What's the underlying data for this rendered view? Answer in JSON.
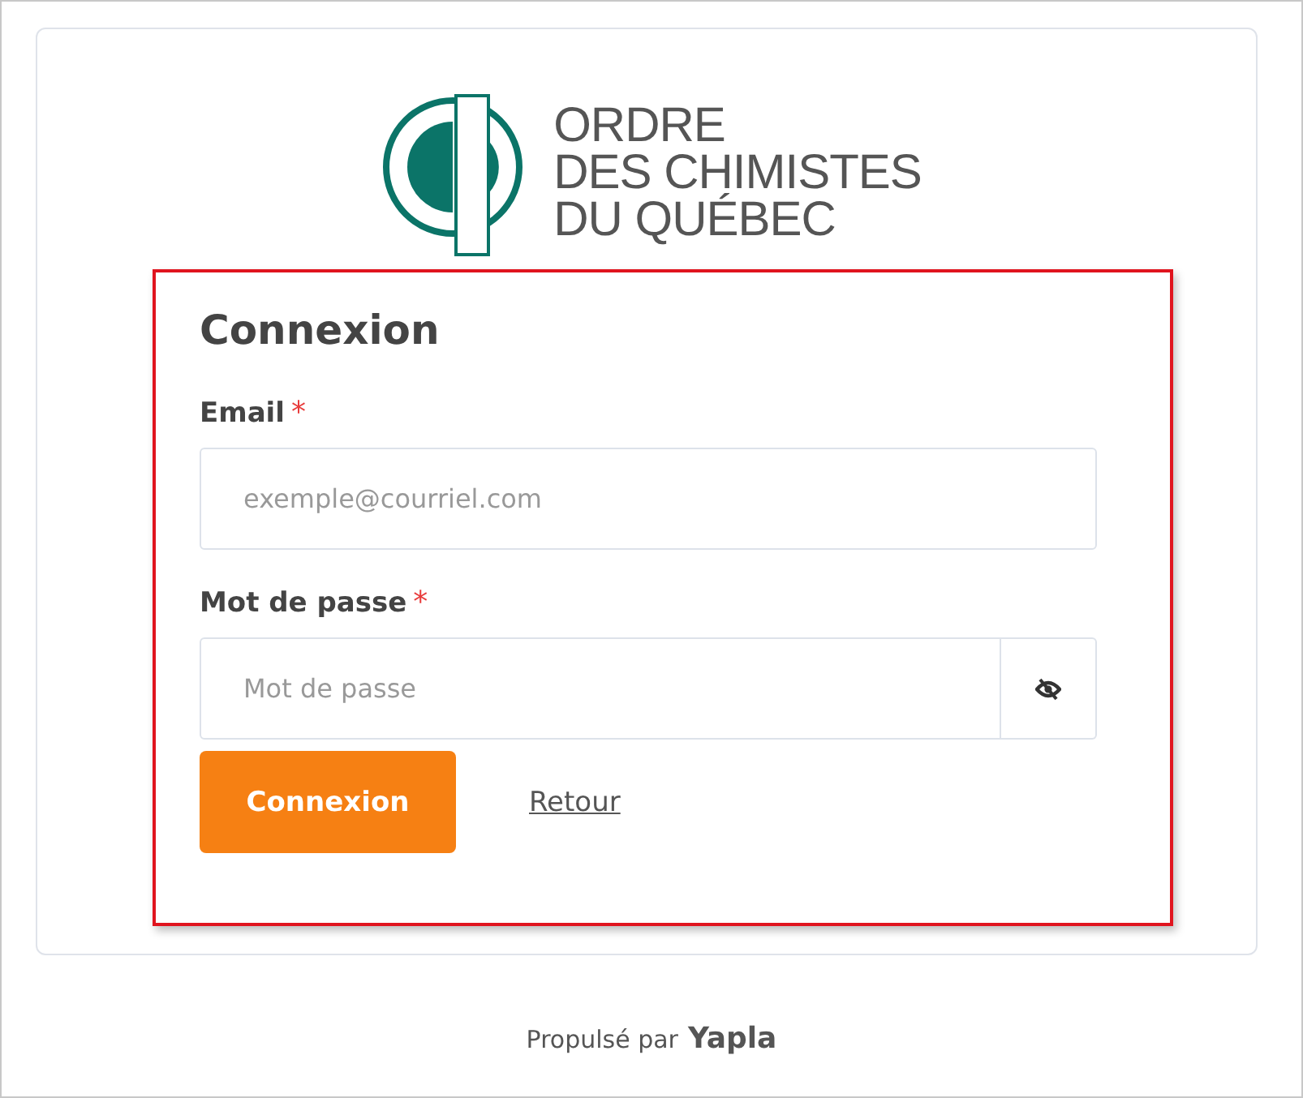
{
  "logo": {
    "lines": [
      "ORDRE",
      "DES CHIMISTES",
      "DU QUÉBEC"
    ]
  },
  "form": {
    "title": "Connexion",
    "fields": [
      {
        "kind": "text",
        "label": "Email",
        "required_mark": "*",
        "placeholder": "exemple@courriel.com",
        "required": true
      },
      {
        "kind": "password",
        "label": "Mot de passe",
        "required_mark": "*",
        "placeholder": "Mot de passe",
        "required": true
      }
    ],
    "submit": "Connexion",
    "back_link": "Retour"
  },
  "footer": {
    "text": "Propulsé par",
    "brand": "Yapla"
  }
}
